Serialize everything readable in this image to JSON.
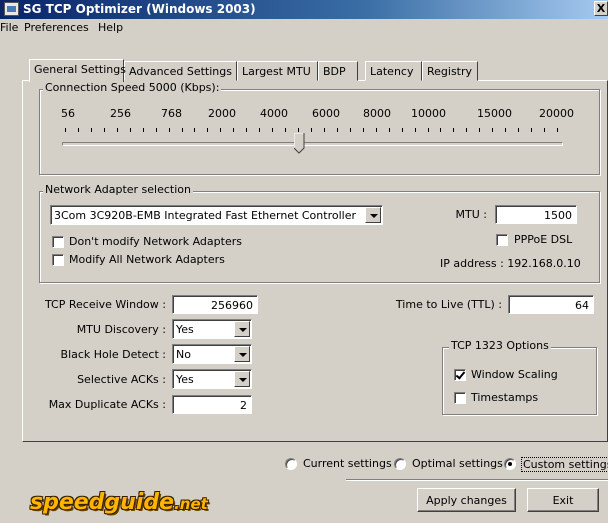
{
  "window": {
    "title": "SG TCP Optimizer (Windows 2003)",
    "close": "X"
  },
  "menu": [
    {
      "label": "File"
    },
    {
      "label": "Preferences"
    },
    {
      "label": "Help"
    }
  ],
  "tabs": [
    {
      "label": "General Settings",
      "active": true
    },
    {
      "label": "Advanced Settings"
    },
    {
      "label": "Largest MTU"
    },
    {
      "label": "BDP"
    },
    {
      "label": "Latency"
    },
    {
      "label": "Registry"
    }
  ],
  "connection_speed": {
    "label": "Connection Speed  5000 (Kbps):",
    "ticks": [
      "56",
      "256",
      "768",
      "2000",
      "4000",
      "6000",
      "8000",
      "10000",
      "15000",
      "20000"
    ],
    "value": 5000,
    "value_unit": "Kbps"
  },
  "adapter": {
    "label": "Network Adapter selection",
    "selected": "3Com 3C920B-EMB Integrated Fast Ethernet Controller",
    "mtu_label": "MTU :",
    "mtu_value": "1500",
    "pppoe_label": "PPPoE DSL",
    "pppoe_checked": false,
    "dont_modify_label": "Don't modify Network Adapters",
    "dont_modify_checked": false,
    "modify_all_label": "Modify All Network Adapters",
    "modify_all_checked": false,
    "ip_label": "IP address : 192.168.0.10"
  },
  "settings": {
    "rwin_label": "TCP Receive Window :",
    "rwin_value": "256960",
    "mtu_discovery_label": "MTU Discovery :",
    "mtu_discovery_value": "Yes",
    "black_hole_label": "Black Hole Detect :",
    "black_hole_value": "No",
    "sack_label": "Selective ACKs :",
    "sack_value": "Yes",
    "max_dup_label": "Max Duplicate ACKs :",
    "max_dup_value": "2",
    "ttl_label": "Time to Live (TTL) :",
    "ttl_value": "64"
  },
  "tcp1323": {
    "label": "TCP 1323 Options",
    "window_scaling_label": "Window Scaling",
    "window_scaling_checked": true,
    "timestamps_label": "Timestamps",
    "timestamps_checked": false
  },
  "modes": [
    {
      "label": "Current settings",
      "selected": false
    },
    {
      "label": "Optimal settings",
      "selected": false
    },
    {
      "label": "Custom settings",
      "selected": true
    }
  ],
  "buttons": {
    "apply": "Apply changes",
    "exit": "Exit"
  },
  "logo": {
    "main": "speedguide",
    "suffix": ".net",
    "color": "#ffb400"
  }
}
